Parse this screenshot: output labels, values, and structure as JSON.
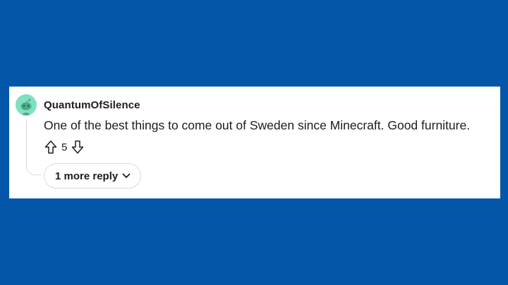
{
  "comment": {
    "author": "QuantumOfSilence",
    "body": "One of the best things to come out of Sweden since Minecraft. Good furniture.",
    "score": "5",
    "more_replies_label": "1 more reply"
  },
  "icons": {
    "avatar": "avatar-icon",
    "upvote": "upvote-arrow-icon",
    "downvote": "downvote-arrow-icon",
    "expand": "chevron-down-icon"
  },
  "colors": {
    "background": "#0457a8",
    "card": "#ffffff",
    "text": "#1c1c1c",
    "avatar": "#7fe0c0",
    "border": "#d7dadc"
  }
}
